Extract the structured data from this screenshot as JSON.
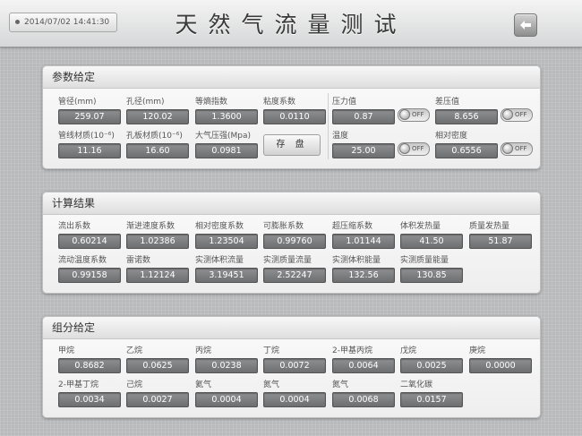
{
  "header": {
    "datetime": "2014/07/02 14:41:30",
    "title": "天然气流量测试"
  },
  "params": {
    "title": "参数给定",
    "fields": [
      {
        "label": "管径(mm)",
        "value": "259.07"
      },
      {
        "label": "孔径(mm)",
        "value": "120.02"
      },
      {
        "label": "等熵指数",
        "value": "1.3600"
      },
      {
        "label": "粘度系数",
        "value": "0.0110"
      },
      {
        "label": "管线材质(10⁻⁶)",
        "value": "11.16"
      },
      {
        "label": "孔板材质(10⁻⁶)",
        "value": "16.60"
      },
      {
        "label": "大气压强(Mpa)",
        "value": "0.0981"
      }
    ],
    "save_label": "存 盘",
    "toggled_fields": [
      {
        "label": "压力值",
        "value": "0.87",
        "toggle": "OFF"
      },
      {
        "label": "差压值",
        "value": "8.656",
        "toggle": "OFF"
      },
      {
        "label": "温度",
        "value": "25.00",
        "toggle": "OFF"
      },
      {
        "label": "相对密度",
        "value": "0.6556",
        "toggle": "OFF"
      }
    ]
  },
  "results": {
    "title": "计算结果",
    "fields": [
      {
        "label": "流出系数",
        "value": "0.60214"
      },
      {
        "label": "渐进速度系数",
        "value": "1.02386"
      },
      {
        "label": "相对密度系数",
        "value": "1.23504"
      },
      {
        "label": "可膨胀系数",
        "value": "0.99760"
      },
      {
        "label": "超压缩系数",
        "value": "1.01144"
      },
      {
        "label": "体积发热量",
        "value": "41.50"
      },
      {
        "label": "质量发热量",
        "value": "51.87"
      },
      {
        "label": "流动温度系数",
        "value": "0.99158"
      },
      {
        "label": "雷诺数",
        "value": "1.12124"
      },
      {
        "label": "实测体积流量",
        "value": "3.19451"
      },
      {
        "label": "实测质量流量",
        "value": "2.52247"
      },
      {
        "label": "实测体积能量",
        "value": "132.56"
      },
      {
        "label": "实测质量能量",
        "value": "130.85"
      }
    ]
  },
  "components": {
    "title": "组分给定",
    "fields": [
      {
        "label": "甲烷",
        "value": "0.8682"
      },
      {
        "label": "乙烷",
        "value": "0.0625"
      },
      {
        "label": "丙烷",
        "value": "0.0238"
      },
      {
        "label": "丁烷",
        "value": "0.0072"
      },
      {
        "label": "2-甲基丙烷",
        "value": "0.0064"
      },
      {
        "label": "戊烷",
        "value": "0.0025"
      },
      {
        "label": "庚烷",
        "value": "0.0000"
      },
      {
        "label": "2-甲基丁烷",
        "value": "0.0034"
      },
      {
        "label": "己烷",
        "value": "0.0027"
      },
      {
        "label": "氦气",
        "value": "0.0004"
      },
      {
        "label": "氮气",
        "value": "0.0004"
      },
      {
        "label": "氮气",
        "value": "0.0068"
      },
      {
        "label": "二氧化碳",
        "value": "0.0157"
      }
    ]
  }
}
